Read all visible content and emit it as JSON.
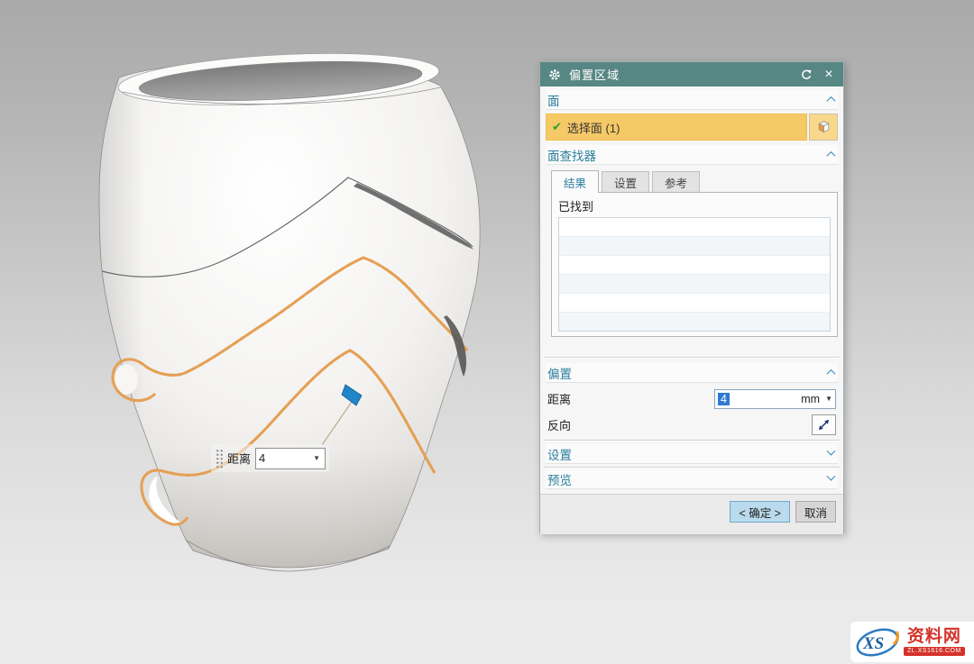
{
  "dialog": {
    "title": "偏置区域",
    "face_section": {
      "label": "面",
      "select_face_label": "选择面 (1)"
    },
    "face_finder": {
      "label": "面查找器",
      "tabs": [
        {
          "label": "结果",
          "active": true
        },
        {
          "label": "设置",
          "active": false
        },
        {
          "label": "参考",
          "active": false
        }
      ],
      "found_label": "已找到",
      "found_items": []
    },
    "offset_section": {
      "label": "偏置",
      "distance_label": "距离",
      "distance_value": "4",
      "distance_unit": "mm",
      "reverse_label": "反向"
    },
    "settings_section": {
      "label": "设置"
    },
    "preview_section": {
      "label": "预览"
    },
    "footer": {
      "ok_label": "< 确定 >",
      "cancel_label": "取消"
    }
  },
  "floating_input": {
    "label": "距离",
    "value": "4"
  },
  "watermark": {
    "monogram": "XS",
    "site_name": "资料网",
    "site_url": "ZL.XS1616.COM"
  },
  "colors": {
    "titlebar": "#578784",
    "selected_row": "#f6c967",
    "text_selection": "#2f7ad1",
    "highlight_edge": "#e5a055",
    "section_header_text": "#2c7f9e",
    "ok_button": "#badbed",
    "direction_arrow": "#1f86c8"
  }
}
